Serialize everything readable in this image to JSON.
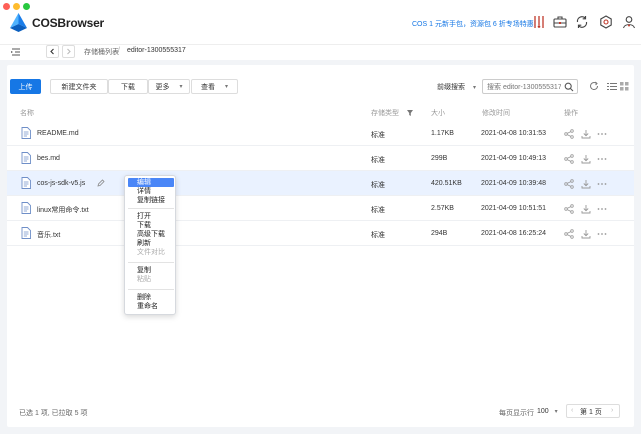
{
  "window": {
    "title": "COSBrowser",
    "promo": "COS 1 元新手包，资源包 6 折专场特惠!"
  },
  "colors": {
    "accent": "#1677e5",
    "close": "#fe5f57",
    "minimize": "#febc2e",
    "zoom": "#28c840"
  },
  "nav": {
    "breadcrumb": [
      "存储桶列表",
      "editor-1300555317"
    ]
  },
  "toolbar": {
    "upload": "上传",
    "new_folder": "新建文件夹",
    "download": "下载",
    "more": "更多",
    "view": "查看",
    "search_mode": "前缀搜索",
    "search_placeholder": "搜索 editor-1300555317"
  },
  "table": {
    "columns": {
      "name": "名称",
      "storage_class": "存储类型",
      "size": "大小",
      "modified": "修改时间",
      "actions": "操作"
    },
    "rows": [
      {
        "name": "README.md",
        "storage_class": "标准",
        "size": "1.17KB",
        "modified": "2021-04-08 10:31:53"
      },
      {
        "name": "bes.md",
        "storage_class": "标准",
        "size": "299B",
        "modified": "2021-04-09 10:49:13"
      },
      {
        "name": "cos-js-sdk-v5.js",
        "storage_class": "标准",
        "size": "420.51KB",
        "modified": "2021-04-09 10:39:48"
      },
      {
        "name": "linux常用命令.txt",
        "storage_class": "标准",
        "size": "2.57KB",
        "modified": "2021-04-09 10:51:51"
      },
      {
        "name": "音乐.txt",
        "storage_class": "标准",
        "size": "294B",
        "modified": "2021-04-08 16:25:24"
      }
    ]
  },
  "context_menu": {
    "items": [
      "编辑",
      "详情",
      "复制链接",
      "打开",
      "下载",
      "高级下载",
      "刷新",
      "文件对比",
      "复制",
      "粘贴",
      "删除",
      "重命名"
    ]
  },
  "footer": {
    "selection": "已选 1 项, 已拉取 5 项",
    "page_size_label": "每页显示行",
    "page_size": "100",
    "page": "第 1 页"
  }
}
